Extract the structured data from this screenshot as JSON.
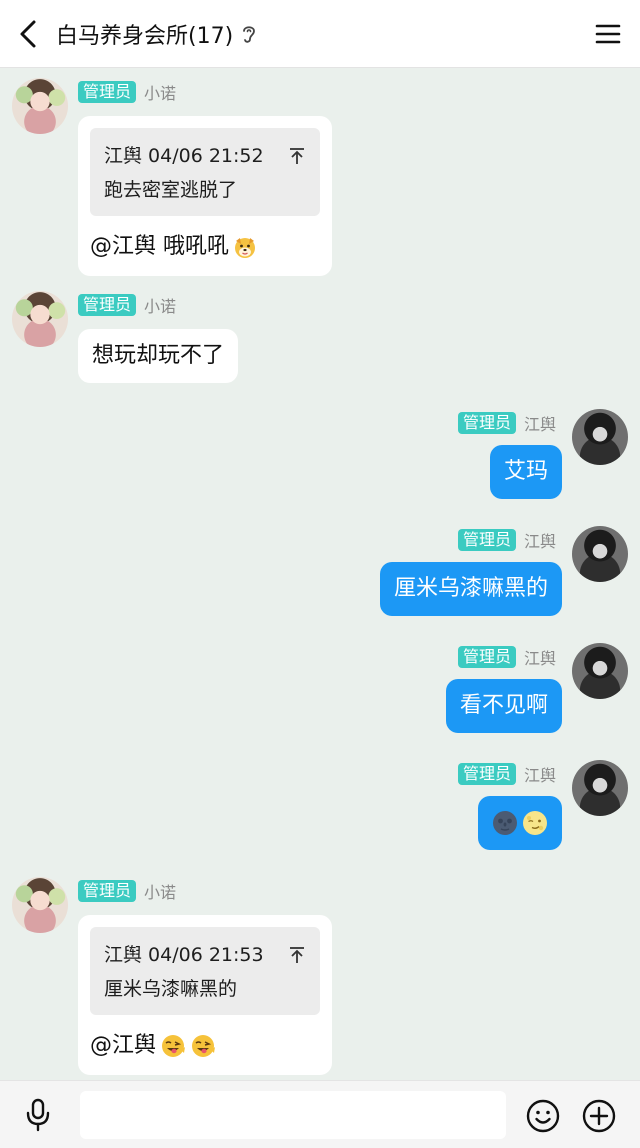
{
  "header": {
    "title": "白马养身会所(17)",
    "back_icon": "chevron-left-icon",
    "ear_icon": "ear-icon",
    "menu_icon": "menu-icon"
  },
  "messages": [
    {
      "side": "left",
      "badge": "管理员",
      "sender": "小诺",
      "quote": {
        "author_time": "江舆 04/06 21:52",
        "text": "跑去密室逃脱了"
      },
      "reply": "@江舆 哦吼吼",
      "emoji": "dog-face-emoji"
    },
    {
      "side": "left",
      "badge": "管理员",
      "sender": "小诺",
      "text": "想玩却玩不了"
    },
    {
      "side": "right",
      "badge": "管理员",
      "sender": "江舆",
      "text": "艾玛"
    },
    {
      "side": "right",
      "badge": "管理员",
      "sender": "江舆",
      "text": "厘米乌漆嘛黑的"
    },
    {
      "side": "right",
      "badge": "管理员",
      "sender": "江舆",
      "text": "看不见啊"
    },
    {
      "side": "right",
      "badge": "管理员",
      "sender": "江舆",
      "emojis": [
        "new-moon-face-emoji",
        "full-moon-face-emoji"
      ]
    },
    {
      "side": "left",
      "badge": "管理员",
      "sender": "小诺",
      "quote": {
        "author_time": "江舆 04/06 21:53",
        "text": "厘米乌漆嘛黑的"
      },
      "reply": "@江舆",
      "emojis": [
        "winking-tongue-face-emoji",
        "winking-tongue-face-emoji"
      ]
    }
  ],
  "inputbar": {
    "mic_icon": "microphone-icon",
    "placeholder": "",
    "emoji_icon": "smiley-icon",
    "plus_icon": "plus-circle-icon"
  },
  "colors": {
    "badge": "#3bcbc1",
    "self_bubble": "#1c98f5",
    "chat_bg": "#eaf0ec"
  }
}
